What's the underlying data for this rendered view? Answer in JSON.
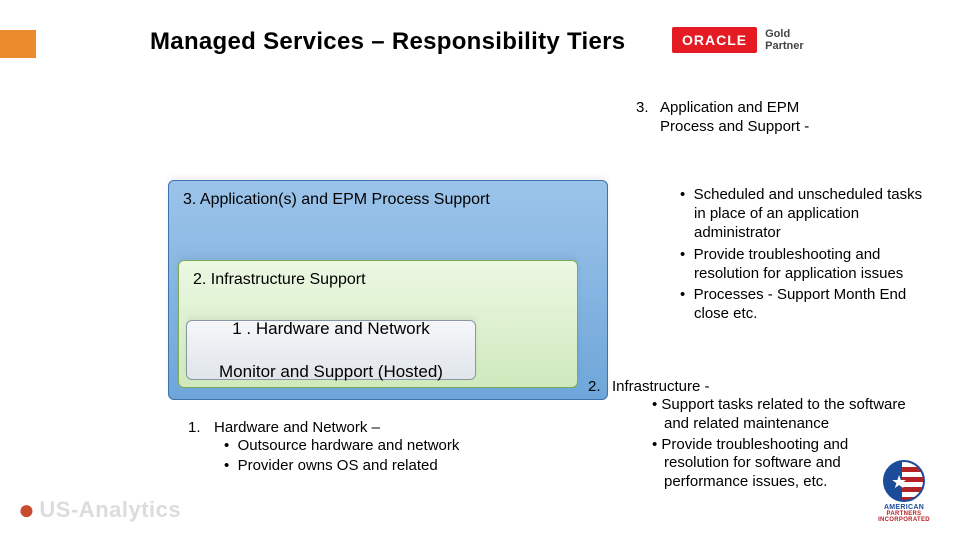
{
  "title": "Managed Services – Responsibility Tiers",
  "badge": {
    "oracle": "ORACLE",
    "line1": "Gold",
    "line2": "Partner"
  },
  "tiers": {
    "t3": "3. Application(s) and EPM Process Support",
    "t2": "2. Infrastructure Support",
    "t1a": "1 . Hardware and Network",
    "t1b": "Monitor and Support (Hosted)"
  },
  "section3": {
    "num": "3.",
    "heading": "Application  and EPM Process and Support -",
    "bullets": [
      "Scheduled and unscheduled tasks in place of an application administrator",
      "Provide troubleshooting and resolution for application issues",
      "Processes - Support Month End close etc."
    ]
  },
  "section2": {
    "num": "2.",
    "heading": "Infrastructure -",
    "bullets": [
      "Support tasks related to the software and related maintenance",
      "Provide troubleshooting and resolution for software and performance issues, etc."
    ]
  },
  "section1": {
    "num": "1.",
    "heading": "Hardware and Network –",
    "bullets": [
      "Outsource hardware and network",
      "Provider owns OS and related"
    ]
  },
  "footer": {
    "left": "US-Analytics",
    "right1": "AMERICAN",
    "right2": "PARTNERS INCORPORATED"
  }
}
